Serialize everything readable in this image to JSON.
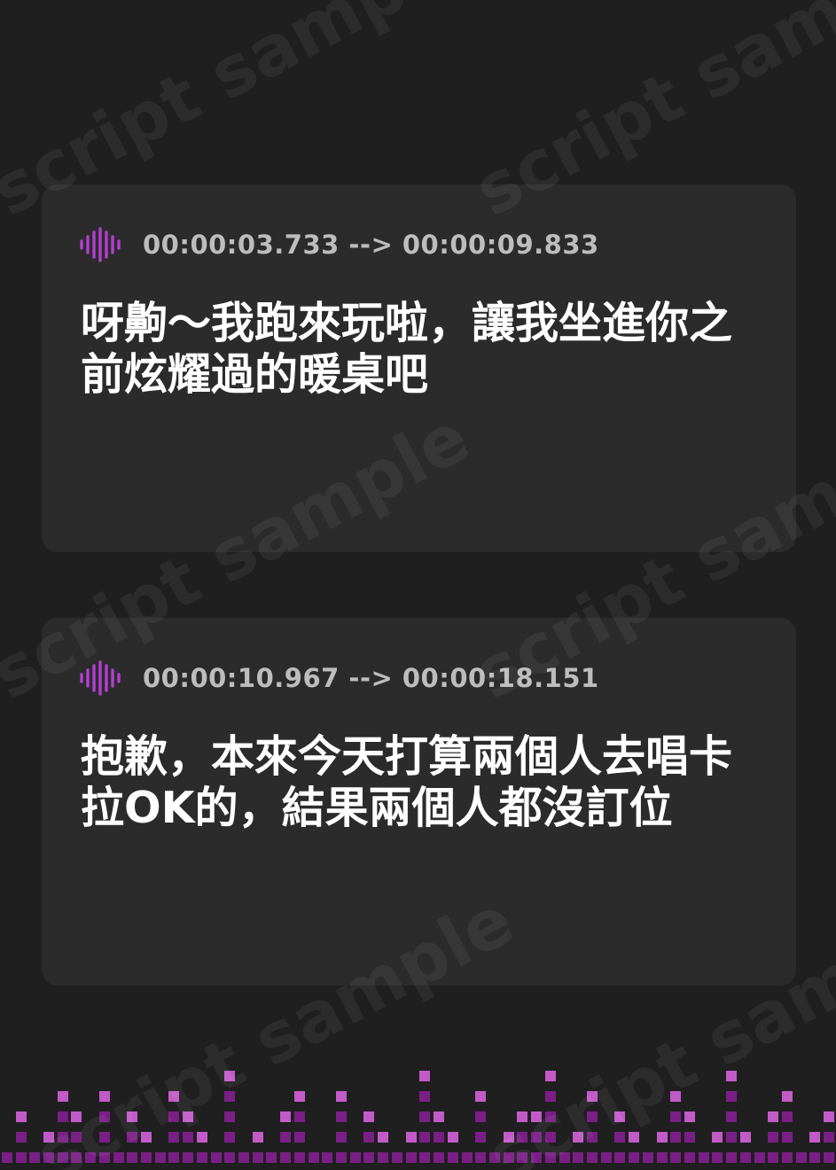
{
  "colors": {
    "background": "#1f1f20",
    "card": "#2b2b2c",
    "accent": "#b33fd0",
    "timestamp_text": "#bdbdbd",
    "subtitle_text": "#ffffff",
    "equalizer_dim": "#7a1f86",
    "equalizer_bright": "#c25bc8"
  },
  "watermark": {
    "text": "script sample"
  },
  "cues": [
    {
      "icon": "sound-wave-icon",
      "timestamp": "00:00:03.733 --> 00:00:09.833",
      "text": "呀齁～我跑來玩啦，讓我坐進你之前炫耀過的暖桌吧"
    },
    {
      "icon": "sound-wave-icon",
      "timestamp": "00:00:10.967 --> 00:00:18.151",
      "text": "抱歉，本來今天打算兩個人去唱卡拉OK的，結果兩個人都沒訂位"
    }
  ],
  "equalizer": {
    "icon": "audio-equalizer-bars",
    "levels": [
      1,
      3,
      1,
      2,
      4,
      3,
      1,
      4,
      1,
      3,
      2,
      1,
      4,
      3,
      2,
      1,
      5,
      1,
      2,
      1,
      3,
      4,
      1,
      1,
      4,
      1,
      3,
      2,
      1,
      2,
      5,
      3,
      2,
      1,
      4,
      1,
      2,
      3,
      3,
      5,
      1,
      2,
      4,
      1,
      3,
      2,
      1,
      2,
      4,
      3,
      1,
      2,
      5,
      2,
      1,
      3,
      4,
      1,
      2,
      3
    ]
  }
}
